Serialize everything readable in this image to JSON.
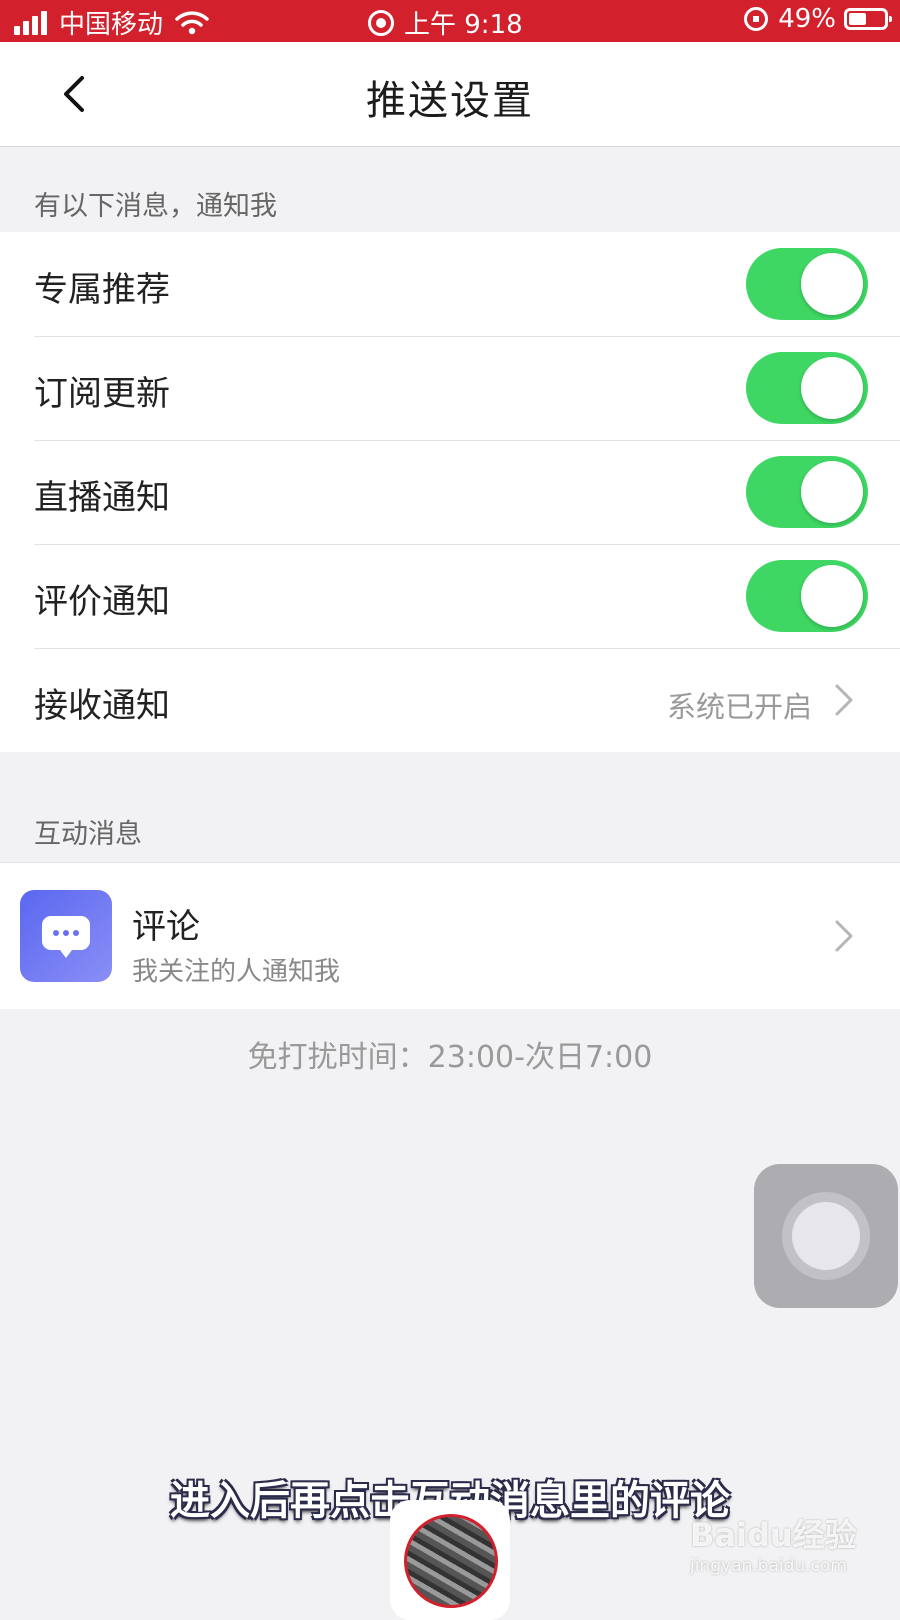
{
  "status_bar": {
    "carrier": "中国移动",
    "time": "上午 9:18",
    "battery": "49%",
    "battery_level": 0.49
  },
  "nav": {
    "title": "推送设置"
  },
  "section_notify": {
    "header": "有以下消息，通知我",
    "items": [
      {
        "label": "专属推荐",
        "on": true
      },
      {
        "label": "订阅更新",
        "on": true
      },
      {
        "label": "直播通知",
        "on": true
      },
      {
        "label": "评价通知",
        "on": true
      }
    ],
    "receive": {
      "label": "接收通知",
      "value": "系统已开启"
    }
  },
  "section_interact": {
    "header": "互动消息",
    "comment": {
      "title": "评论",
      "subtitle": "我关注的人通知我"
    }
  },
  "dnd": "免打扰时间：23:00-次日7:00",
  "caption": "进入后再点击互动消息里的评论",
  "watermark": {
    "logo": "Baidu经验",
    "url": "jingyan.baidu.com"
  },
  "colors": {
    "status_bar": "#d2212c",
    "toggle_on": "#3fd763",
    "background": "#f2f2f4"
  }
}
